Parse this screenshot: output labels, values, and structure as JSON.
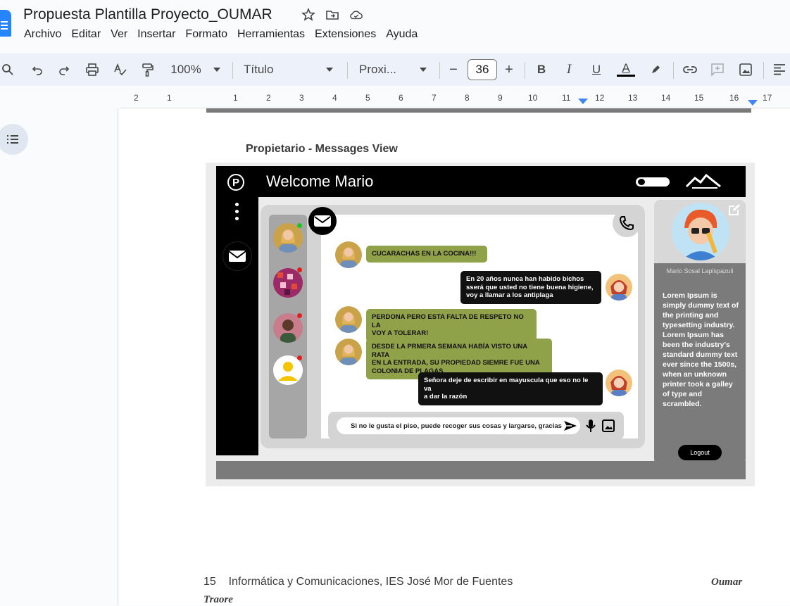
{
  "app": {
    "doc_title": "Propuesta Plantilla Proyecto_OUMAR",
    "title_icons": [
      "star-icon",
      "move-to-folder-icon",
      "cloud-saved-icon"
    ],
    "menu": [
      "Archivo",
      "Editar",
      "Ver",
      "Insertar",
      "Formato",
      "Herramientas",
      "Extensiones",
      "Ayuda"
    ],
    "brand_color": "#2684fc"
  },
  "toolbar": {
    "zoom": "100%",
    "style": "Título",
    "font": "Proxi...",
    "font_size": "36",
    "minus": "−",
    "plus": "+",
    "bold": "B",
    "italic": "I",
    "underline": "U",
    "text_color": "A"
  },
  "ruler": {
    "numbers": [
      "2",
      "1",
      "1",
      "2",
      "3",
      "4",
      "5",
      "6",
      "7",
      "8",
      "9",
      "10",
      "11",
      "12",
      "13",
      "14",
      "15",
      "16",
      "17"
    ]
  },
  "document": {
    "section_heading": "Propietario - Messages View",
    "footer": "15    Informática y Comunicaciones, IES José Mor de Fuentes",
    "footer_author_1": "Oumar",
    "footer_author_2": "Traore"
  },
  "mockup": {
    "logo": "P",
    "welcome": "Welcome Mario",
    "accent_green": "#8fa24a",
    "messages": [
      {
        "dir": "in",
        "text": "CUCARACHAS EN LA COCINA!!!"
      },
      {
        "dir": "out",
        "text": "En 20 años nunca han habido bichos\nsserá que usted no tiene buena higiene,\nvoy a llamar a los antiplaga"
      },
      {
        "dir": "in",
        "text": "PERDONA PERO ESTA FALTA DE RESPETO NO LA\nVOY A TOLERAR!"
      },
      {
        "dir": "in",
        "text": "DESDE LA PRMERA SEMANA HABÍA VISTO UNA RATA\nEN LA ENTRADA, SU PROPIEDAD SIEMRE FUE UNA\nCOLONIA DE PLAGAS"
      },
      {
        "dir": "out",
        "text": "Señora deje de escribir en mayuscula que eso no le va\na dar la razón"
      }
    ],
    "input_text": "Si no le gusta el piso, puede recoger sus cosas y largarse, gracias",
    "profile_name": "Mario Sosal Lapispazuli",
    "profile_text": "Lorem Ipsum is simply dummy text of the printing and typesetting industry. Lorem Ipsum has been the industry's standard dummy text ever since the 1500s, when an unknown printer took a galley of type and scrambled.",
    "logout": "Logout"
  }
}
